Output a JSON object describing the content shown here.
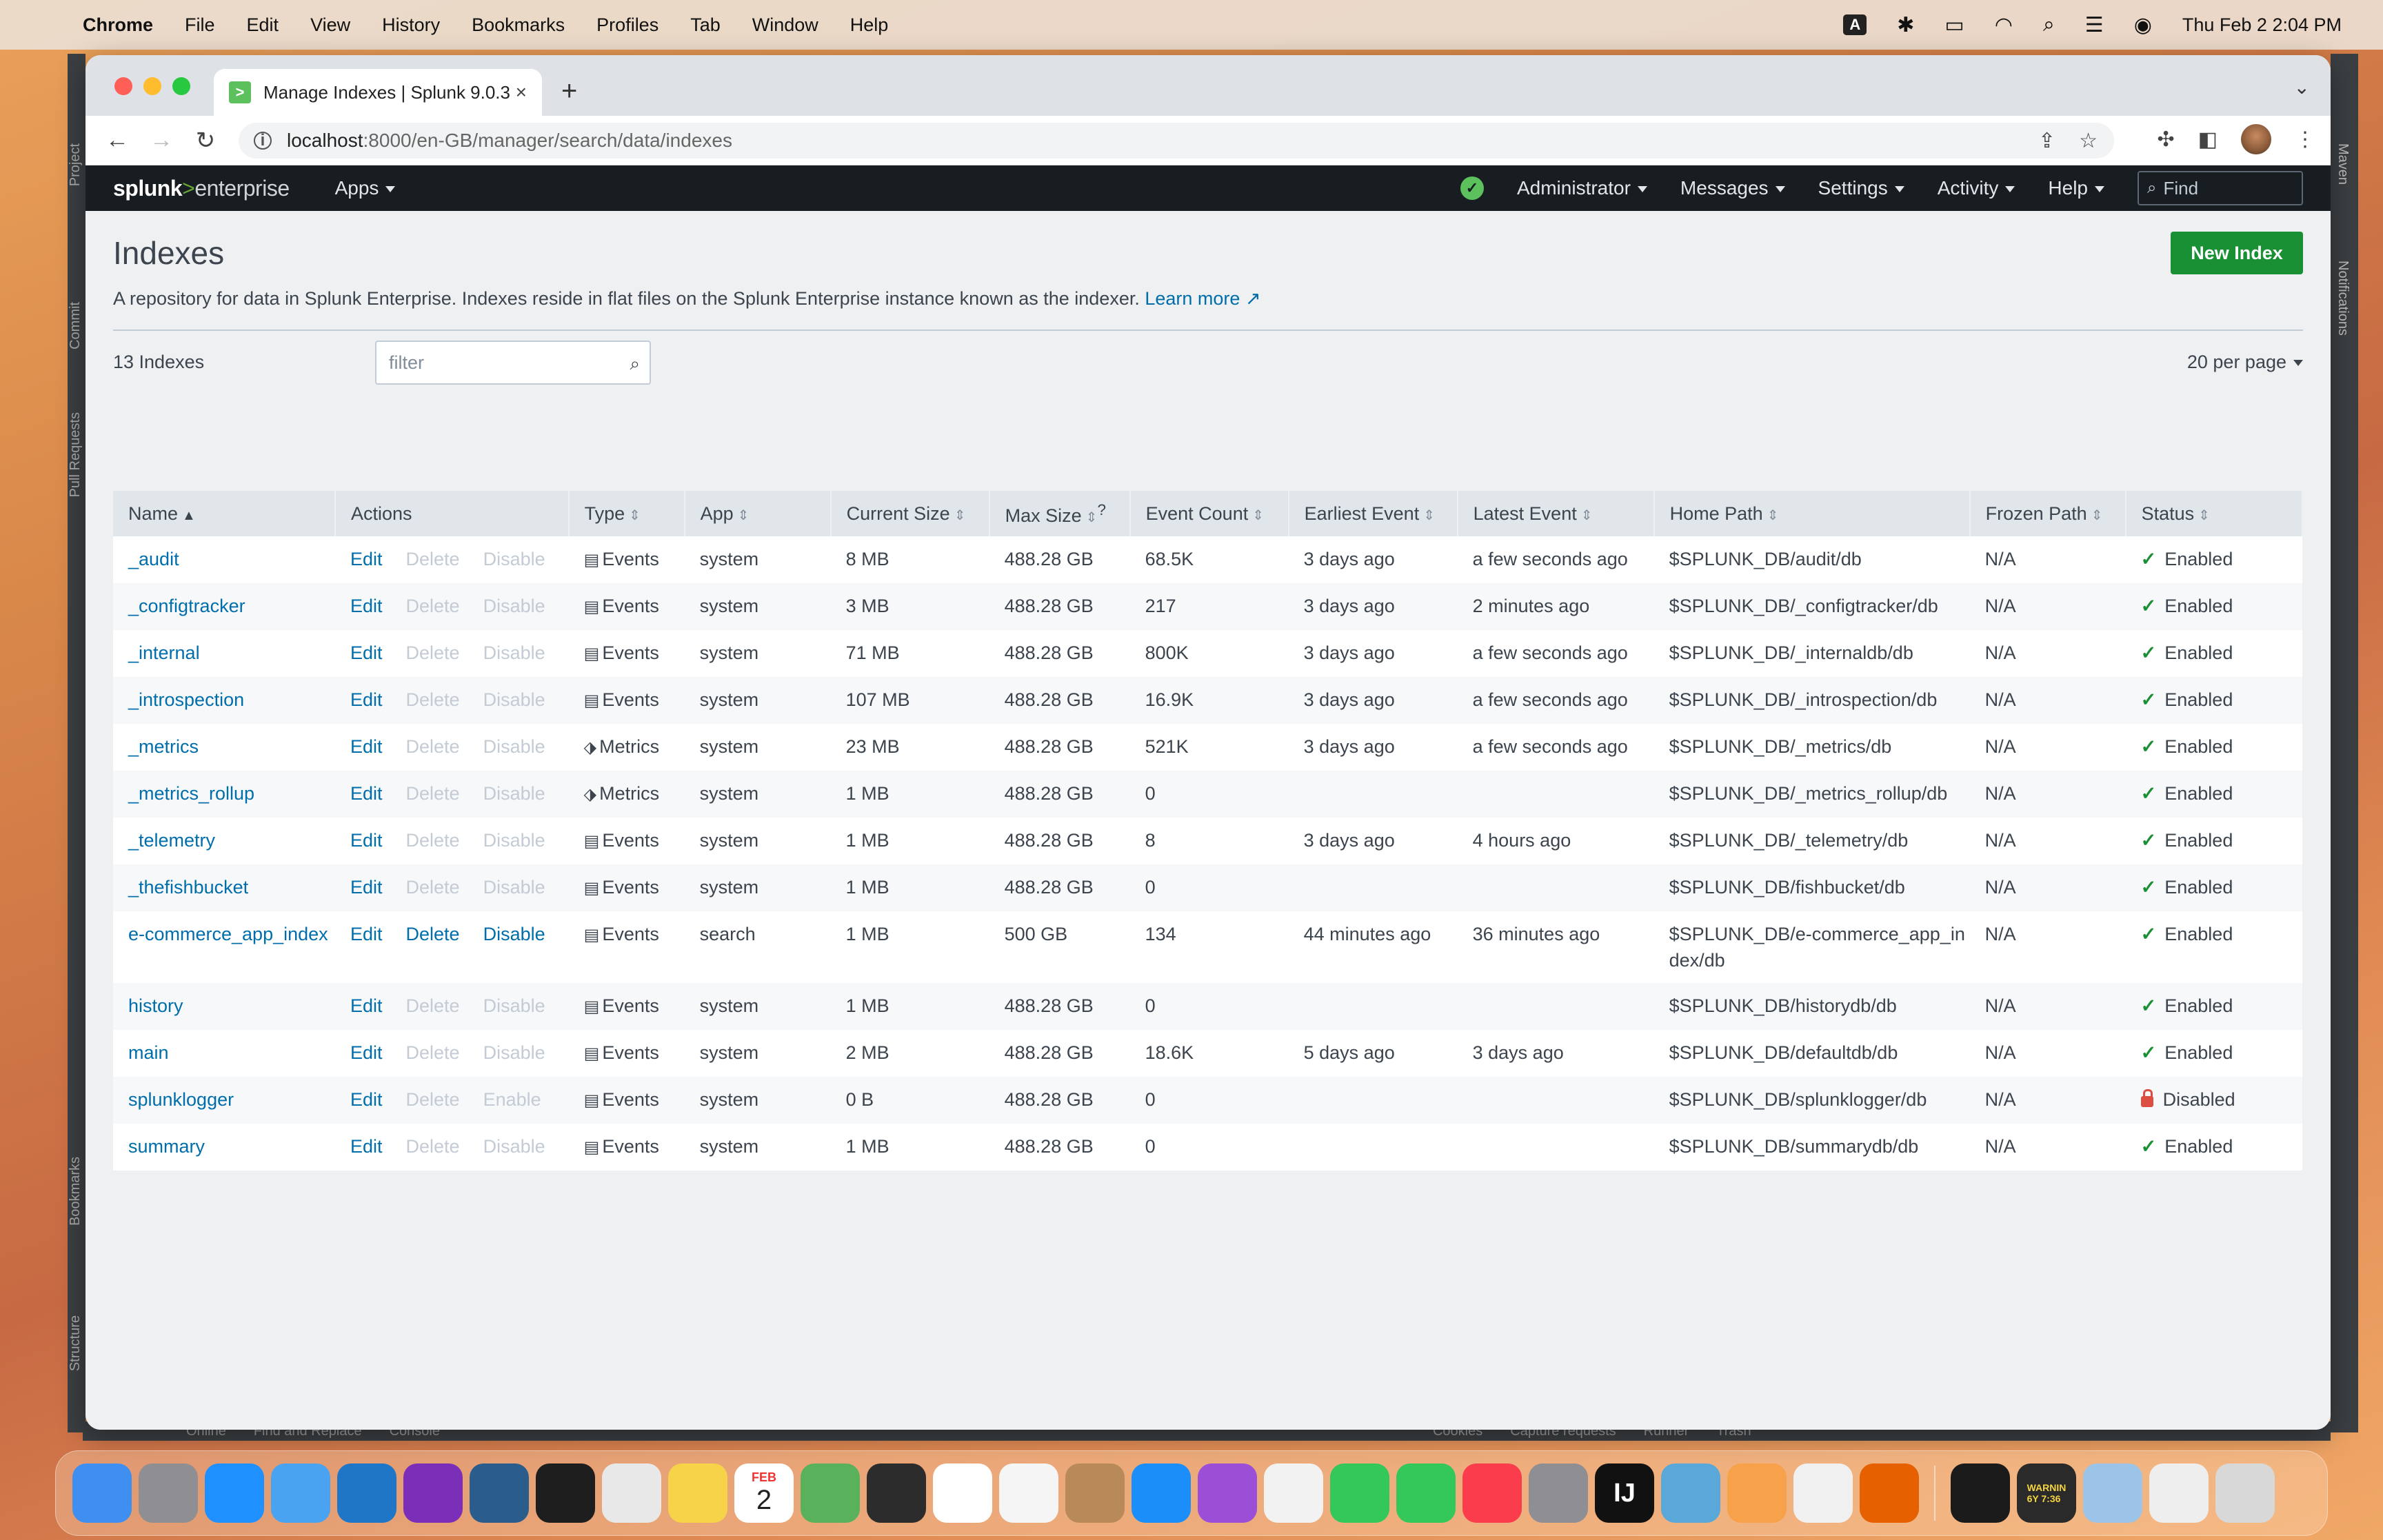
{
  "menubar": {
    "app_name": "Chrome",
    "items": [
      "File",
      "Edit",
      "View",
      "History",
      "Bookmarks",
      "Profiles",
      "Tab",
      "Window",
      "Help"
    ],
    "clock": "Thu Feb 2  2:04 PM",
    "input_badge": "A"
  },
  "ide": {
    "left_labels": [
      "Project",
      "Commit",
      "Pull Requests",
      "Bookmarks",
      "Structure"
    ],
    "right_labels": [
      "Maven",
      "Notifications"
    ],
    "bottom_items": [
      "Online",
      "Find and Replace",
      "Console",
      "Cookies",
      "Capture requests",
      "Runner",
      "Trash"
    ]
  },
  "browser": {
    "tab_title": "Manage Indexes | Splunk 9.0.3",
    "url_host": "localhost",
    "url_path": ":8000/en-GB/manager/search/data/indexes"
  },
  "splunk": {
    "logo_main": "splunk",
    "logo_gt": ">",
    "logo_sub": "enterprise",
    "apps": "Apps",
    "nav": [
      "Administrator",
      "Messages",
      "Settings",
      "Activity",
      "Help"
    ],
    "find_placeholder": "Find"
  },
  "page": {
    "title": "Indexes",
    "description": "A repository for data in Splunk Enterprise. Indexes reside in flat files on the Splunk Enterprise instance known as the indexer.",
    "learn_more": "Learn more",
    "new_index": "New Index",
    "count": "13 Indexes",
    "filter_placeholder": "filter",
    "per_page": "20 per page"
  },
  "table": {
    "headers": [
      "Name",
      "Actions",
      "Type",
      "App",
      "Current Size",
      "Max Size",
      "Event Count",
      "Earliest Event",
      "Latest Event",
      "Home Path",
      "Frozen Path",
      "Status"
    ],
    "max_size_superscript": "?",
    "rows": [
      {
        "name": "_audit",
        "edit": "Edit",
        "delete": "Delete",
        "toggle": "Disable",
        "actions_enabled": false,
        "type": "Events",
        "app": "system",
        "current": "8 MB",
        "max": "488.28 GB",
        "events": "68.5K",
        "earliest": "3 days ago",
        "latest": "a few seconds ago",
        "home": "$SPLUNK_DB/audit/db",
        "frozen": "N/A",
        "status": "Enabled"
      },
      {
        "name": "_configtracker",
        "edit": "Edit",
        "delete": "Delete",
        "toggle": "Disable",
        "actions_enabled": false,
        "type": "Events",
        "app": "system",
        "current": "3 MB",
        "max": "488.28 GB",
        "events": "217",
        "earliest": "3 days ago",
        "latest": "2 minutes ago",
        "home": "$SPLUNK_DB/_configtracker/db",
        "frozen": "N/A",
        "status": "Enabled"
      },
      {
        "name": "_internal",
        "edit": "Edit",
        "delete": "Delete",
        "toggle": "Disable",
        "actions_enabled": false,
        "type": "Events",
        "app": "system",
        "current": "71 MB",
        "max": "488.28 GB",
        "events": "800K",
        "earliest": "3 days ago",
        "latest": "a few seconds ago",
        "home": "$SPLUNK_DB/_internaldb/db",
        "frozen": "N/A",
        "status": "Enabled"
      },
      {
        "name": "_introspection",
        "edit": "Edit",
        "delete": "Delete",
        "toggle": "Disable",
        "actions_enabled": false,
        "type": "Events",
        "app": "system",
        "current": "107 MB",
        "max": "488.28 GB",
        "events": "16.9K",
        "earliest": "3 days ago",
        "latest": "a few seconds ago",
        "home": "$SPLUNK_DB/_introspection/db",
        "frozen": "N/A",
        "status": "Enabled"
      },
      {
        "name": "_metrics",
        "edit": "Edit",
        "delete": "Delete",
        "toggle": "Disable",
        "actions_enabled": false,
        "type": "Metrics",
        "app": "system",
        "current": "23 MB",
        "max": "488.28 GB",
        "events": "521K",
        "earliest": "3 days ago",
        "latest": "a few seconds ago",
        "home": "$SPLUNK_DB/_metrics/db",
        "frozen": "N/A",
        "status": "Enabled"
      },
      {
        "name": "_metrics_rollup",
        "edit": "Edit",
        "delete": "Delete",
        "toggle": "Disable",
        "actions_enabled": false,
        "type": "Metrics",
        "app": "system",
        "current": "1 MB",
        "max": "488.28 GB",
        "events": "0",
        "earliest": "",
        "latest": "",
        "home": "$SPLUNK_DB/_metrics_rollup/db",
        "frozen": "N/A",
        "status": "Enabled"
      },
      {
        "name": "_telemetry",
        "edit": "Edit",
        "delete": "Delete",
        "toggle": "Disable",
        "actions_enabled": false,
        "type": "Events",
        "app": "system",
        "current": "1 MB",
        "max": "488.28 GB",
        "events": "8",
        "earliest": "3 days ago",
        "latest": "4 hours ago",
        "home": "$SPLUNK_DB/_telemetry/db",
        "frozen": "N/A",
        "status": "Enabled"
      },
      {
        "name": "_thefishbucket",
        "edit": "Edit",
        "delete": "Delete",
        "toggle": "Disable",
        "actions_enabled": false,
        "type": "Events",
        "app": "system",
        "current": "1 MB",
        "max": "488.28 GB",
        "events": "0",
        "earliest": "",
        "latest": "",
        "home": "$SPLUNK_DB/fishbucket/db",
        "frozen": "N/A",
        "status": "Enabled"
      },
      {
        "name": "e-commerce_app_index",
        "edit": "Edit",
        "delete": "Delete",
        "toggle": "Disable",
        "actions_enabled": true,
        "type": "Events",
        "app": "search",
        "current": "1 MB",
        "max": "500 GB",
        "events": "134",
        "earliest": "44 minutes ago",
        "latest": "36 minutes ago",
        "home": "$SPLUNK_DB/e-commerce_app_index/db",
        "frozen": "N/A",
        "status": "Enabled"
      },
      {
        "name": "history",
        "edit": "Edit",
        "delete": "Delete",
        "toggle": "Disable",
        "actions_enabled": false,
        "type": "Events",
        "app": "system",
        "current": "1 MB",
        "max": "488.28 GB",
        "events": "0",
        "earliest": "",
        "latest": "",
        "home": "$SPLUNK_DB/historydb/db",
        "frozen": "N/A",
        "status": "Enabled"
      },
      {
        "name": "main",
        "edit": "Edit",
        "delete": "Delete",
        "toggle": "Disable",
        "actions_enabled": false,
        "type": "Events",
        "app": "system",
        "current": "2 MB",
        "max": "488.28 GB",
        "events": "18.6K",
        "earliest": "5 days ago",
        "latest": "3 days ago",
        "home": "$SPLUNK_DB/defaultdb/db",
        "frozen": "N/A",
        "status": "Enabled"
      },
      {
        "name": "splunklogger",
        "edit": "Edit",
        "delete": "Delete",
        "toggle": "Enable",
        "actions_enabled": false,
        "type": "Events",
        "app": "system",
        "current": "0 B",
        "max": "488.28 GB",
        "events": "0",
        "earliest": "",
        "latest": "",
        "home": "$SPLUNK_DB/splunklogger/db",
        "frozen": "N/A",
        "status": "Disabled"
      },
      {
        "name": "summary",
        "edit": "Edit",
        "delete": "Delete",
        "toggle": "Disable",
        "actions_enabled": false,
        "type": "Events",
        "app": "system",
        "current": "1 MB",
        "max": "488.28 GB",
        "events": "0",
        "earliest": "",
        "latest": "",
        "home": "$SPLUNK_DB/summarydb/db",
        "frozen": "N/A",
        "status": "Enabled"
      }
    ]
  },
  "dock": {
    "calendar_month": "FEB",
    "calendar_day": "2",
    "intellij_label": "IJ",
    "console_label": "WARNIN\n6Y 7:36",
    "apps": [
      {
        "name": "finder-icon",
        "color": "#3f8ff0"
      },
      {
        "name": "launchpad-icon",
        "color": "#8e8e93"
      },
      {
        "name": "safari-icon",
        "color": "#1e90ff"
      },
      {
        "name": "mail-icon",
        "color": "#4aa3f0"
      },
      {
        "name": "vscode-icon",
        "color": "#1f75c6"
      },
      {
        "name": "onenote-icon",
        "color": "#7b2fb8"
      },
      {
        "name": "mysql-workbench-icon",
        "color": "#2a5d8c"
      },
      {
        "name": "terminal-icon",
        "color": "#1e1e1e"
      },
      {
        "name": "chrome-icon",
        "color": "#e8e8e8"
      },
      {
        "name": "notes-icon",
        "color": "#f7d34a"
      },
      {
        "name": "calendar-icon",
        "color": "#ffffff"
      },
      {
        "name": "maps-icon",
        "color": "#59b15b"
      },
      {
        "name": "quicktime-icon",
        "color": "#2c2c2c"
      },
      {
        "name": "reminders-icon",
        "color": "#ffffff"
      },
      {
        "name": "photos-icon",
        "color": "#f5f5f5"
      },
      {
        "name": "contacts-icon",
        "color": "#b88a5a"
      },
      {
        "name": "app-store-icon",
        "color": "#1c8ef9"
      },
      {
        "name": "podcasts-icon",
        "color": "#9b4fd6"
      },
      {
        "name": "news-icon",
        "color": "#f2f2f2"
      },
      {
        "name": "numbers-icon",
        "color": "#34c759"
      },
      {
        "name": "facetime-icon",
        "color": "#34c759"
      },
      {
        "name": "music-icon",
        "color": "#fa3c4c"
      },
      {
        "name": "system-settings-icon",
        "color": "#8e8e93"
      },
      {
        "name": "intellij-icon",
        "color": "#111111"
      },
      {
        "name": "virtualbox-icon",
        "color": "#5aa7d9"
      },
      {
        "name": "sketch-icon",
        "color": "#f7a24a"
      },
      {
        "name": "textedit-icon",
        "color": "#f0f0f0"
      },
      {
        "name": "firefox-icon",
        "color": "#e66000"
      },
      {
        "name": "activity-monitor-icon",
        "color": "#1b1b1b"
      },
      {
        "name": "console-icon",
        "color": "#2a2a2a"
      },
      {
        "name": "preview-icon",
        "color": "#9cc3e8"
      },
      {
        "name": "documents-icon",
        "color": "#eeeeee"
      },
      {
        "name": "trash-icon",
        "color": "#d8d8d8"
      }
    ]
  }
}
